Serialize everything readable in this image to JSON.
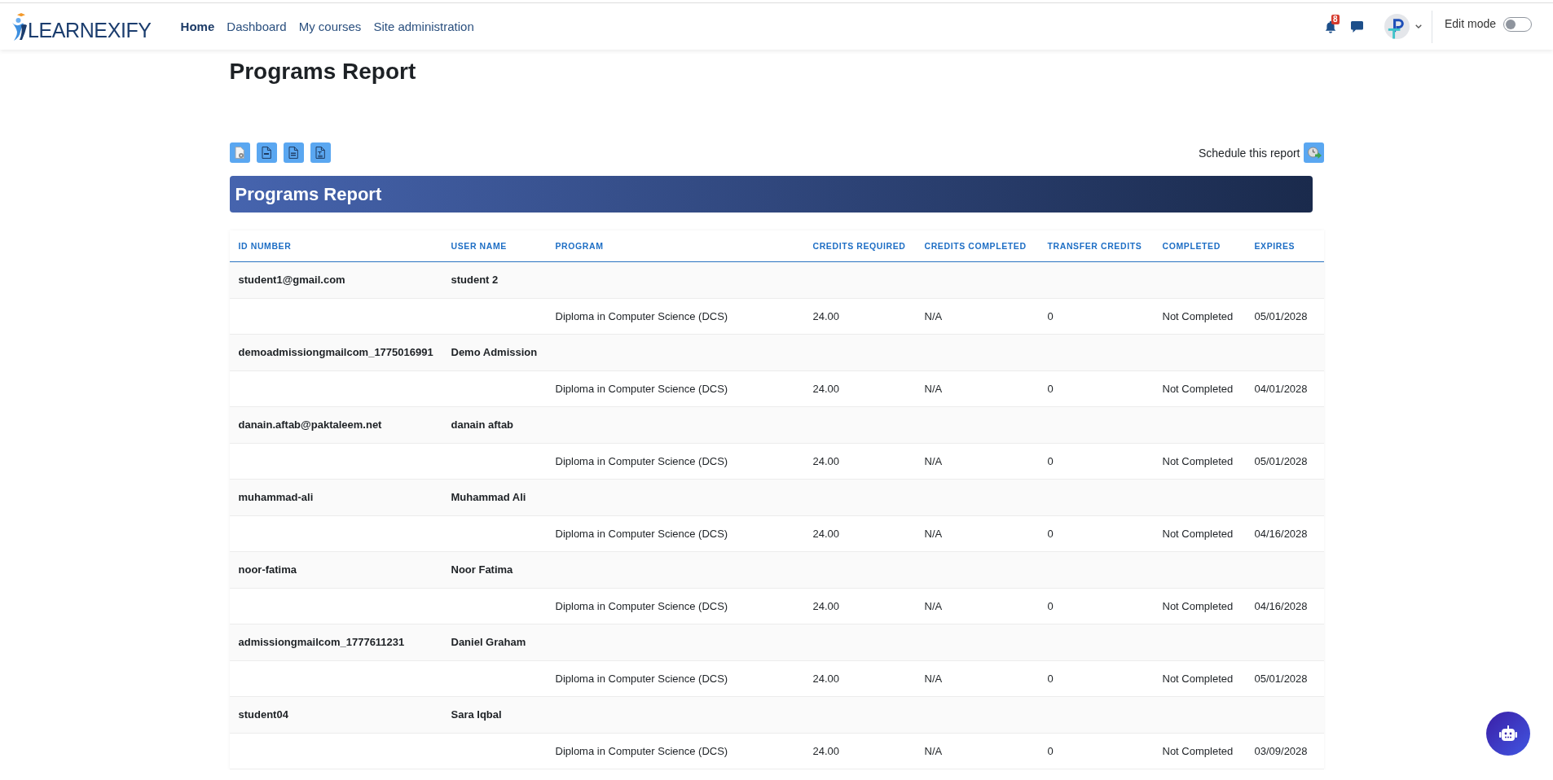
{
  "navbar": {
    "logo_text": "LEARNEXIFY",
    "links": [
      {
        "label": "Home",
        "selected": true
      },
      {
        "label": "Dashboard",
        "selected": false
      },
      {
        "label": "My courses",
        "selected": false
      },
      {
        "label": "Site administration",
        "selected": false
      }
    ],
    "notification_count": "8",
    "edit_mode": {
      "label": "Edit mode",
      "on": false
    }
  },
  "page_title": "Programs Report",
  "schedule": {
    "label": "Schedule this report"
  },
  "report": {
    "title": "Programs Report",
    "columns": [
      "ID NUMBER",
      "USER NAME",
      "PROGRAM",
      "CREDITS REQUIRED",
      "CREDITS COMPLETED",
      "TRANSFER CREDITS",
      "COMPLETED",
      "EXPIRES"
    ],
    "students": [
      {
        "id_number": "student1@gmail.com",
        "user_name": "student 2",
        "programs": [
          {
            "program": "Diploma in Computer Science (DCS)",
            "credits_required": "24.00",
            "credits_completed": "N/A",
            "transfer_credits": "0",
            "completed": "Not Completed",
            "expires": "05/01/2028"
          }
        ]
      },
      {
        "id_number": "demoadmissiongmailcom_1775016991",
        "user_name": "Demo Admission",
        "programs": [
          {
            "program": "Diploma in Computer Science (DCS)",
            "credits_required": "24.00",
            "credits_completed": "N/A",
            "transfer_credits": "0",
            "completed": "Not Completed",
            "expires": "04/01/2028"
          }
        ]
      },
      {
        "id_number": "danain.aftab@paktaleem.net",
        "user_name": "danain aftab",
        "programs": [
          {
            "program": "Diploma in Computer Science (DCS)",
            "credits_required": "24.00",
            "credits_completed": "N/A",
            "transfer_credits": "0",
            "completed": "Not Completed",
            "expires": "05/01/2028"
          }
        ]
      },
      {
        "id_number": "muhammad-ali",
        "user_name": "Muhammad Ali",
        "programs": [
          {
            "program": "Diploma in Computer Science (DCS)",
            "credits_required": "24.00",
            "credits_completed": "N/A",
            "transfer_credits": "0",
            "completed": "Not Completed",
            "expires": "04/16/2028"
          }
        ]
      },
      {
        "id_number": "noor-fatima",
        "user_name": "Noor Fatima",
        "programs": [
          {
            "program": "Diploma in Computer Science (DCS)",
            "credits_required": "24.00",
            "credits_completed": "N/A",
            "transfer_credits": "0",
            "completed": "Not Completed",
            "expires": "04/16/2028"
          }
        ]
      },
      {
        "id_number": "admissiongmailcom_1777611231",
        "user_name": "Daniel Graham",
        "programs": [
          {
            "program": "Diploma in Computer Science (DCS)",
            "credits_required": "24.00",
            "credits_completed": "N/A",
            "transfer_credits": "0",
            "completed": "Not Completed",
            "expires": "05/01/2028"
          }
        ]
      },
      {
        "id_number": "student04",
        "user_name": "Sara Iqbal",
        "programs": [
          {
            "program": "Diploma in Computer Science (DCS)",
            "credits_required": "24.00",
            "credits_completed": "N/A",
            "transfer_credits": "0",
            "completed": "Not Completed",
            "expires": "03/09/2028"
          }
        ]
      }
    ]
  }
}
